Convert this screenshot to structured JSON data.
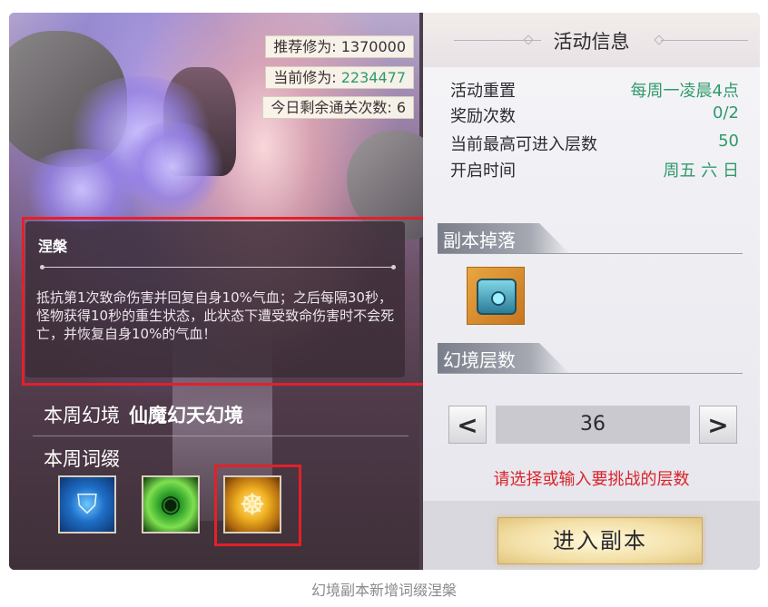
{
  "left": {
    "recommended_label": "推荐修为:",
    "recommended_value": "1370000",
    "current_label": "当前修为:",
    "current_value": "2234477",
    "remaining_label": "今日剩余通关次数:",
    "remaining_value": "6",
    "affix_detail": {
      "title": "涅槃",
      "text": "抵抗第1次致命伤害并回复自身10%气血；之后每隔30秒，怪物获得10秒的重生状态，此状态下遭受致命伤害时不会死亡，并恢复自身10%的气血！"
    },
    "week_realm_label": "本周幻境",
    "week_realm_value": "仙魔幻天幻境",
    "week_affix_label": "本周词缀",
    "affixes": [
      {
        "icon": "shield-icon"
      },
      {
        "icon": "green-eye-icon"
      },
      {
        "icon": "golden-buddha-icon"
      }
    ]
  },
  "right": {
    "info_title": "活动信息",
    "rows": [
      {
        "key": "活动重置",
        "value": "每周一凌晨4点"
      },
      {
        "key": "奖励次数",
        "value": "0/2"
      },
      {
        "key": "当前最高可进入层数",
        "value": "50"
      },
      {
        "key": "开启时间",
        "value": "周五 六 日"
      }
    ],
    "drop_section": "副本掉落",
    "drop_item": {
      "icon": "treasure-chest-icon"
    },
    "floor_section": "幻境层数",
    "floor_value": "36",
    "prev_symbol": "<",
    "next_symbol": ">",
    "hint": "请选择或输入要挑战的层数",
    "enter_button": "进入副本"
  },
  "caption": "幻境副本新增词缀涅槃",
  "colors": {
    "highlight_red": "#e3202a",
    "value_green": "#2f9a6a",
    "hint_red": "#d8242c"
  }
}
